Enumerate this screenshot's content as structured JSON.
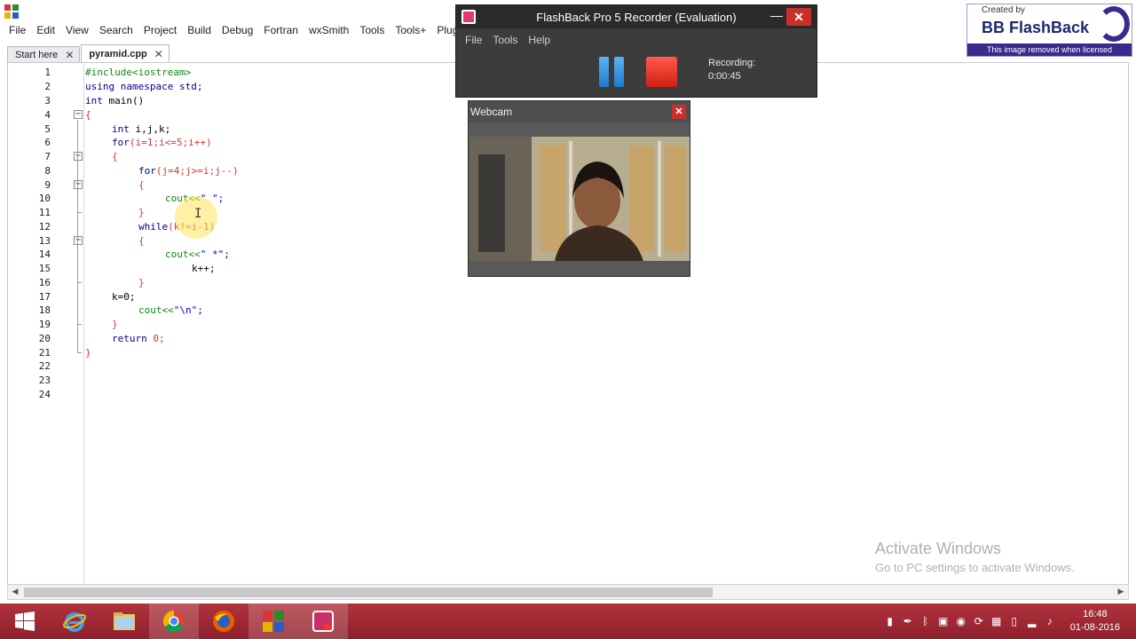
{
  "menubar": [
    "File",
    "Edit",
    "View",
    "Search",
    "Project",
    "Build",
    "Debug",
    "Fortran",
    "wxSmith",
    "Tools",
    "Tools+",
    "Plugins"
  ],
  "tabs": [
    {
      "label": "Start here",
      "active": false
    },
    {
      "label": "pyramid.cpp",
      "active": true
    }
  ],
  "line_numbers": [
    "1",
    "2",
    "3",
    "4",
    "5",
    "6",
    "7",
    "8",
    "9",
    "10",
    "11",
    "12",
    "13",
    "14",
    "15",
    "16",
    "17",
    "18",
    "19",
    "20",
    "21",
    "22",
    "23",
    "24"
  ],
  "code": {
    "l1": "#include<iostream>",
    "l2a": "using",
    "l2b": "namespace",
    "l2c": "std;",
    "l3a": "int",
    "l3b": "main()",
    "l4": "{",
    "l5a": "int",
    "l5b": "i,j,k;",
    "l6a": "for",
    "l6b": "(i=1;i<=5;i++)",
    "l7": "{",
    "l8a": "for",
    "l8b": "(j=4;j>=i;j--)",
    "l9": "{",
    "l10a": "cout<<",
    "l10b": "\" \";",
    "l11": "}",
    "l12a": "while",
    "l12b": "(k!=i-1)",
    "l13": "{",
    "l14a": "cout<<",
    "l14b": "\" *\";",
    "l15": "k++;",
    "l16": "}",
    "l17": "k=0;",
    "l18a": "cout<<",
    "l18b": "\"\\n\";",
    "l19": "}",
    "l20a": "return",
    "l20b": "0;",
    "l21": "}"
  },
  "watermark": {
    "line1": "Activate Windows",
    "line2": "Go to PC settings to activate Windows."
  },
  "recorder": {
    "title": "FlashBack Pro 5 Recorder (Evaluation)",
    "menu": [
      "File",
      "Tools",
      "Help"
    ],
    "status_label": "Recording:",
    "status_time": "0:00:45"
  },
  "webcam": {
    "title": "Webcam"
  },
  "badge": {
    "created_by": "Created by",
    "brand": "BB FlashBack",
    "license": "This image removed when licensed"
  },
  "taskbar": {
    "time": "16:48",
    "date": "01-08-2016",
    "apps": [
      "internet-explorer",
      "file-explorer",
      "chrome",
      "firefox",
      "codeblocks",
      "flashback"
    ]
  },
  "colors": {
    "taskbar": "#9e2634",
    "keyword": "#00008b",
    "preprocessor": "#118811",
    "number": "#dd3333",
    "string": "#0000cc"
  }
}
